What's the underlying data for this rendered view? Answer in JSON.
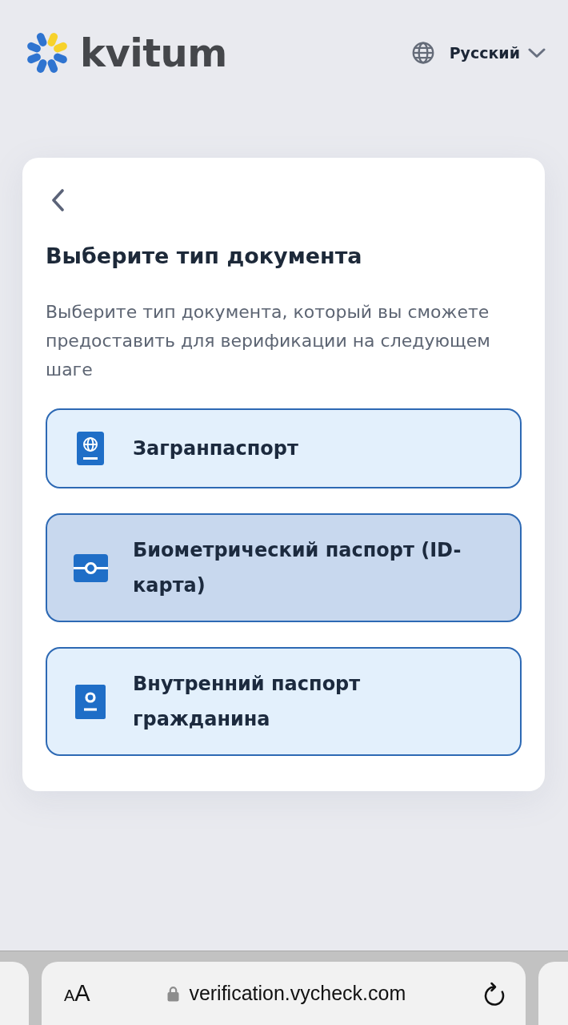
{
  "header": {
    "logo": "kvitum",
    "language": {
      "label": "Русский"
    }
  },
  "card": {
    "title": "Выберите тип документа",
    "description": "Выберите тип документа, который вы сможете предоставить для верификации на следующем шаге",
    "options": [
      {
        "kind": "passport",
        "label": "Загранпаспорт",
        "selected": false
      },
      {
        "kind": "id_card",
        "label": "Биометрический паспорт (ID-карта)",
        "selected": true
      },
      {
        "kind": "internal_passport",
        "label": "Внутренний паспорт гражданина",
        "selected": false
      }
    ]
  },
  "browser_bar": {
    "text_size_button": "AA",
    "url": "verification.vycheck.com"
  }
}
